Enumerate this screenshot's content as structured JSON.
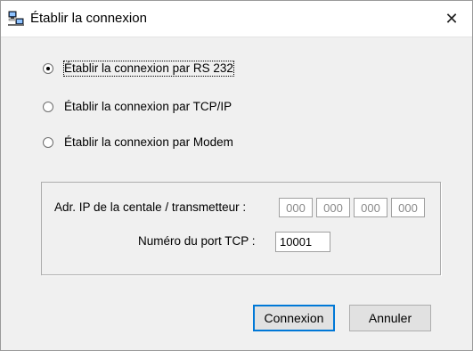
{
  "window": {
    "title": "Établir la connexion",
    "close_glyph": "✕",
    "icon": "network-computer-icon"
  },
  "connection_options": [
    {
      "label": "Établir la connexion par RS 232",
      "selected": true
    },
    {
      "label": "Établir la connexion par TCP/IP",
      "selected": false
    },
    {
      "label": "Établir la connexion par Modem",
      "selected": false
    }
  ],
  "network": {
    "ip_label": "Adr. IP de la centale / transmetteur :",
    "ip_octets": [
      "000",
      "000",
      "000",
      "000"
    ],
    "port_label": "Numéro du port TCP :",
    "port_value": "10001"
  },
  "buttons": {
    "connect": "Connexion",
    "cancel": "Annuler"
  },
  "colors": {
    "dialog_bg": "#f0f0f0",
    "default_button_border": "#0078d7"
  }
}
